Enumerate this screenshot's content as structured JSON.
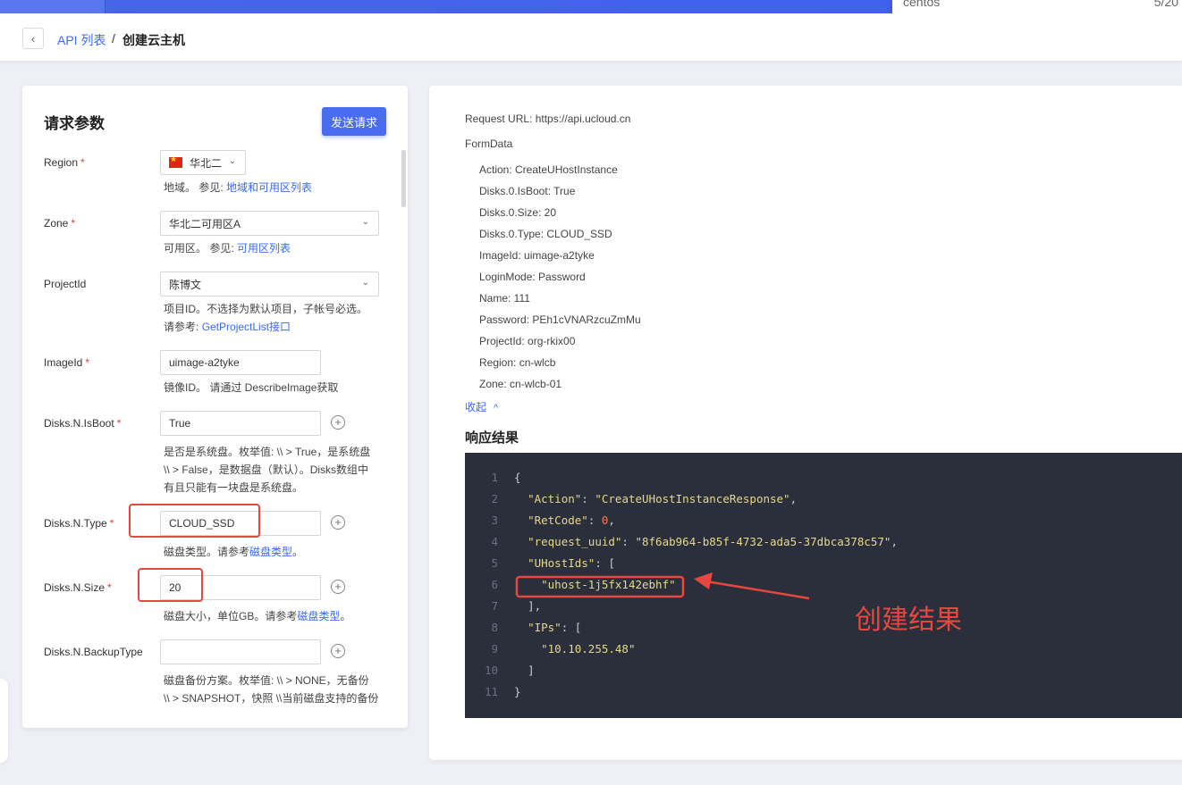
{
  "top_popup": {
    "left_text": "centos",
    "right_text": "5/20"
  },
  "breadcrumb": {
    "back_icon": "‹",
    "link": "API 列表",
    "separator": "/",
    "current": "创建云主机"
  },
  "left_panel": {
    "title": "请求参数",
    "send_button": "发送请求",
    "fields": {
      "region": {
        "label": "Region",
        "required": "*",
        "value": "华北二",
        "hint": "地域。 参见:",
        "hint_link": "地域和可用区列表"
      },
      "zone": {
        "label": "Zone",
        "required": "*",
        "value": "华北二可用区A",
        "hint": "可用区。 参见:",
        "hint_link": "可用区列表"
      },
      "project": {
        "label": "ProjectId",
        "value": "陈博文",
        "hint_line1": "项目ID。不选择为默认项目，子帐号必选。",
        "hint_line2": "请参考:",
        "hint_link": "GetProjectList接口"
      },
      "image": {
        "label": "ImageId",
        "required": "*",
        "value": "uimage-a2tyke",
        "hint": "镜像ID。 请通过 DescribeImage获取"
      },
      "isboot": {
        "label": "Disks.N.IsBoot",
        "required": "*",
        "value": "True",
        "hint_line1": "是否是系统盘。枚举值: \\\\ > True，是系统盘",
        "hint_line2": "\\\\ > False，是数据盘（默认）。Disks数组中",
        "hint_line3": "有且只能有一块盘是系统盘。"
      },
      "type": {
        "label": "Disks.N.Type",
        "required": "*",
        "value": "CLOUD_SSD",
        "hint": "磁盘类型。请参考",
        "hint_link": "磁盘类型",
        "hint_end": "。"
      },
      "size": {
        "label": "Disks.N.Size",
        "required": "*",
        "value": "20",
        "hint": "磁盘大小，单位GB。请参考",
        "hint_link": "磁盘类型",
        "hint_end": "。"
      },
      "backup": {
        "label": "Disks.N.BackupType",
        "value": "",
        "hint_line1": "磁盘备份方案。枚举值: \\\\ > NONE，无备份",
        "hint_line2": "\\\\ > SNAPSHOT，快照 \\\\当前磁盘支持的备份"
      }
    },
    "plus_icon": "+",
    "chevron_icon": "⌄"
  },
  "right_panel": {
    "request_url": "Request URL: https://api.ucloud.cn",
    "formdata_title": "FormData",
    "formdata": [
      "Action: CreateUHostInstance",
      "Disks.0.IsBoot: True",
      "Disks.0.Size: 20",
      "Disks.0.Type: CLOUD_SSD",
      "ImageId: uimage-a2tyke",
      "LoginMode: Password",
      "Name: 111",
      "Password: PEh1cVNARzcuZmMu",
      "ProjectId: org-rkix00",
      "Region: cn-wlcb",
      "Zone: cn-wlcb-01"
    ],
    "collapse_label": "收起",
    "collapse_icon": "^",
    "response_title": "响应结果",
    "code": {
      "line_numbers": [
        "1",
        "2",
        "3",
        "4",
        "5",
        "6",
        "7",
        "8",
        "9",
        "10",
        "11"
      ],
      "l1": "{",
      "l2_key": "\"Action\"",
      "l2_colon": ": ",
      "l2_val": "\"CreateUHostInstanceResponse\"",
      "l2_end": ",",
      "l3_key": "\"RetCode\"",
      "l3_colon": ": ",
      "l3_val": "0",
      "l3_end": ",",
      "l4_key": "\"request_uuid\"",
      "l4_colon": ": ",
      "l4_val": "\"8f6ab964-b85f-4732-ada5-37dbca378c57\"",
      "l4_end": ",",
      "l5_key": "\"UHostIds\"",
      "l5_colon": ": ",
      "l5_val": "[",
      "l6_val": "\"uhost-1j5fx142ebhf\"",
      "l7": "],",
      "l8_key": "\"IPs\"",
      "l8_colon": ": ",
      "l8_val": "[",
      "l9_val": "\"10.10.255.48\"",
      "l10": "]",
      "l11": "}"
    }
  },
  "annotation": {
    "text": "创建结果",
    "color": "#e8473f"
  },
  "colors": {
    "accent": "#3a6bf0",
    "topbar": "#4866e8",
    "required": "#e0393e",
    "code_bg": "#2b2e3b",
    "annotation_red": "#e8473f"
  }
}
